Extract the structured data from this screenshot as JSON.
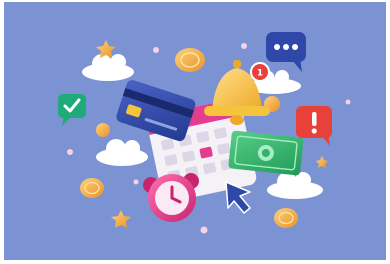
{
  "illustration": {
    "background_color": "#7b93d2",
    "notification_count": "1",
    "accent_colors": {
      "bell": "#f6c43c",
      "badge": "#e8413a",
      "chat_bubble": "#2f47a8",
      "check_bubble": "#1faa79",
      "alert_bubble": "#e8413a",
      "card": "#2f47a8",
      "cash": "#2fb36b",
      "clock": "#e23d8f",
      "calendar": "#f4f1f7",
      "calendar_highlight": "#e23d8f",
      "coin": "#f2a93b",
      "cloud": "#ffffff",
      "cursor": "#2f47a8"
    },
    "elements": [
      "calendar-icon",
      "bell-icon",
      "notification-badge",
      "credit-card-icon",
      "cash-icon",
      "alarm-clock-icon",
      "cursor-arrow-icon",
      "chat-bubble-icon",
      "check-bubble-icon",
      "alert-bubble-icon",
      "coin-icon",
      "cloud",
      "star-icon"
    ]
  }
}
